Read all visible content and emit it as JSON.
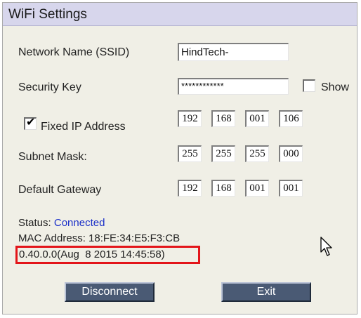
{
  "window": {
    "title": "WiFi Settings"
  },
  "form": {
    "ssid_label": "Network Name (SSID)",
    "ssid_value": "HindTech-",
    "key_label": "Security Key",
    "key_value": "************",
    "show_label": "Show",
    "show_checked": false,
    "fixed_ip_label": "Fixed IP Address",
    "fixed_ip_checked": true,
    "ip": [
      "192",
      "168",
      "001",
      "106"
    ],
    "subnet_label": "Subnet Mask:",
    "subnet": [
      "255",
      "255",
      "255",
      "000"
    ],
    "gateway_label": "Default Gateway",
    "gateway": [
      "192",
      "168",
      "001",
      "001"
    ]
  },
  "info": {
    "status_label": "Status:",
    "status_value": "Connected",
    "mac_label": "MAC Address: 18:FE:34:E5:F3:CB",
    "version": "0.40.0.0(Aug  8 2015 14:45:58)"
  },
  "buttons": {
    "disconnect": "Disconnect",
    "exit": "Exit"
  },
  "colors": {
    "status": "#1a2fc8",
    "highlight_box": "#e3151a",
    "button": "#4a5a74"
  }
}
